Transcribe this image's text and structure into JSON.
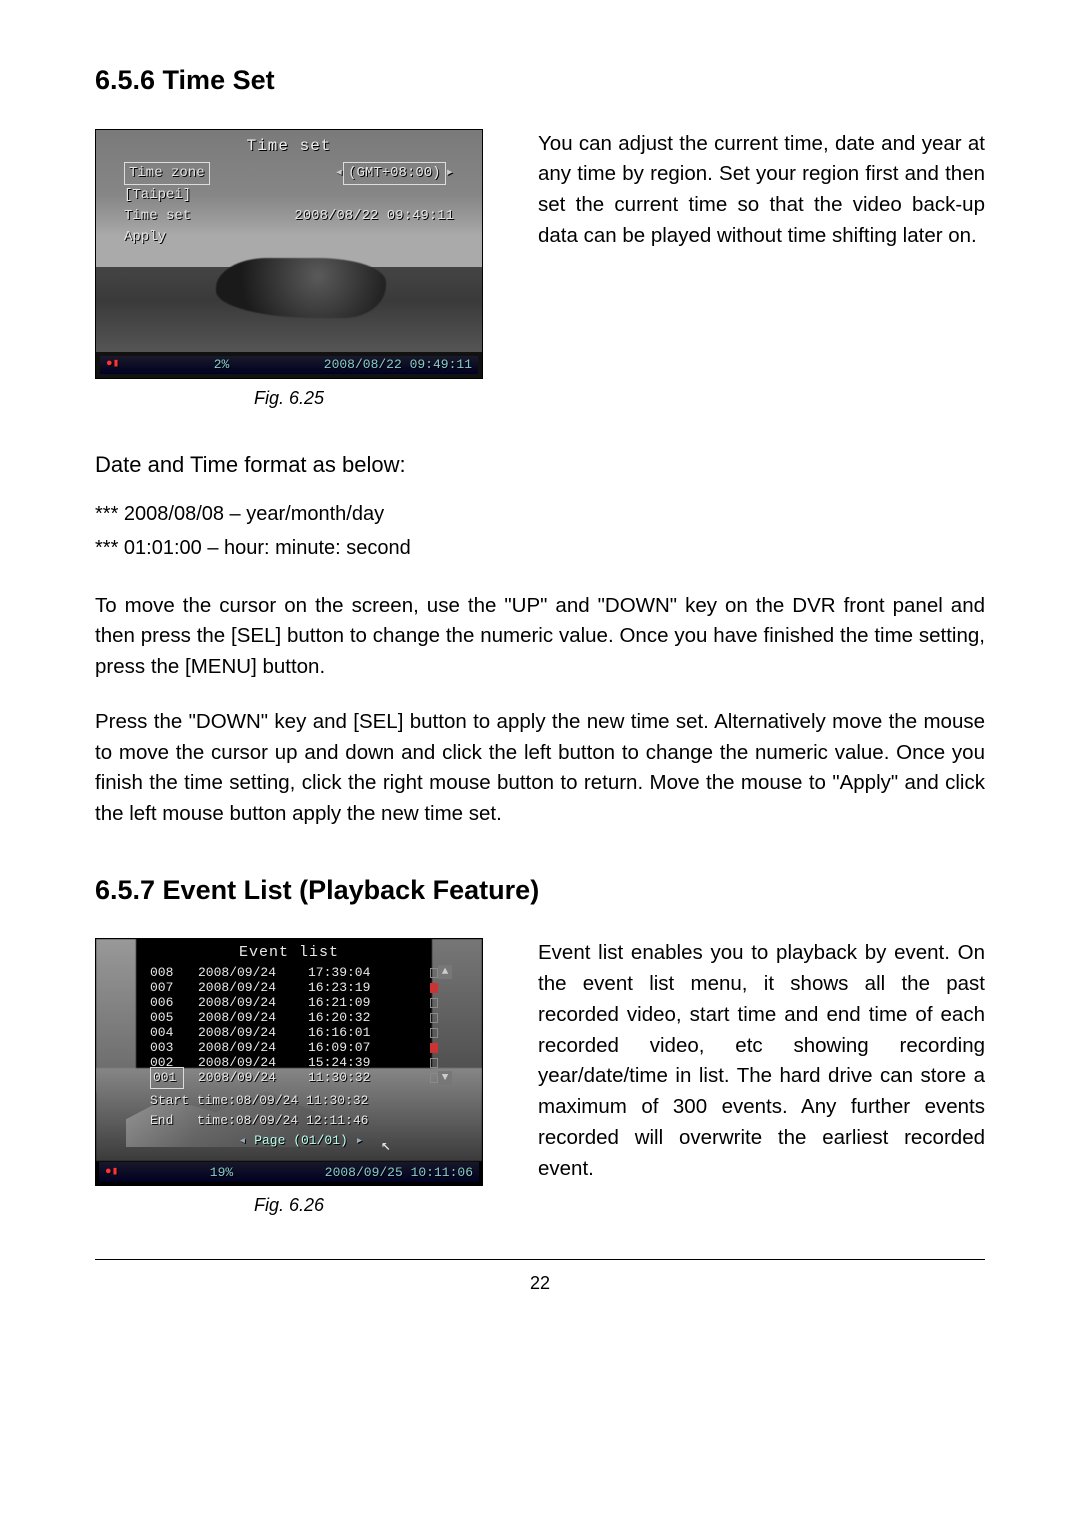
{
  "page_number": "22",
  "section656": {
    "heading": "6.5.6  Time Set",
    "figure": {
      "caption": "Fig. 6.25",
      "title": "Time set",
      "menu": [
        {
          "label": "Time zone",
          "value": "(GMT+08:00)",
          "boxed": true
        },
        {
          "label": "[Taipei]",
          "value": ""
        },
        {
          "label": "Time set",
          "value": "2008/08/22 09:49:11"
        },
        {
          "label": "Apply",
          "value": ""
        }
      ],
      "status_percent": "2%",
      "status_time": "2008/08/22 09:49:11"
    },
    "right_para": "You can adjust the current time, date and year at any time by region.  Set your region first and then set the current time so that the video back-up data can be played without time shifting later on.",
    "subhead": "Date and Time format as below:",
    "fmt1": "*** 2008/08/08 – year/month/day",
    "fmt2": "*** 01:01:00 – hour:  minute:  second",
    "para2": "To move the cursor on the screen, use the \"UP\" and \"DOWN\" key on the DVR front panel and then press the [SEL] button to change the numeric value.  Once you have finished the time setting, press the [MENU] button.",
    "para3": "Press the \"DOWN\" key and [SEL] button to apply the new time set.  Alternatively move the mouse to move the cursor up and down and click the left button to change the numeric value.  Once you finish the time setting, click the right mouse button to return.  Move the mouse to \"Apply\" and click the left mouse button apply the new time set."
  },
  "section657": {
    "heading": "6.5.7  Event List (Playback Feature)",
    "figure": {
      "caption": "Fig. 6.26",
      "title": "Event list",
      "events": [
        {
          "id": "008",
          "date": "2008/09/24",
          "time": "17:39:04",
          "rec": false
        },
        {
          "id": "007",
          "date": "2008/09/24",
          "time": "16:23:19",
          "rec": true
        },
        {
          "id": "006",
          "date": "2008/09/24",
          "time": "16:21:09",
          "rec": false
        },
        {
          "id": "005",
          "date": "2008/09/24",
          "time": "16:20:32",
          "rec": false
        },
        {
          "id": "004",
          "date": "2008/09/24",
          "time": "16:16:01",
          "rec": false
        },
        {
          "id": "003",
          "date": "2008/09/24",
          "time": "16:09:07",
          "rec": true
        },
        {
          "id": "002",
          "date": "2008/09/24",
          "time": "15:24:39",
          "rec": false
        },
        {
          "id": "001",
          "date": "2008/09/24",
          "time": "11:30:32",
          "rec": false,
          "selected": true
        }
      ],
      "start_label": "Start",
      "start_value": "time:08/09/24 11:30:32",
      "end_label": "End",
      "end_value": "time:08/09/24 12:11:46",
      "page": "Page (01/01)",
      "status_percent": "19%",
      "status_time": "2008/09/25 10:11:06"
    },
    "right_para": "Event list enables you to playback by event.  On the event list menu, it shows all the past recorded video, start time and end time of each recorded video, etc showing recording year/date/time in list.  The hard drive can store a maximum of 300 events.  Any further events recorded will overwrite the earliest recorded event."
  }
}
